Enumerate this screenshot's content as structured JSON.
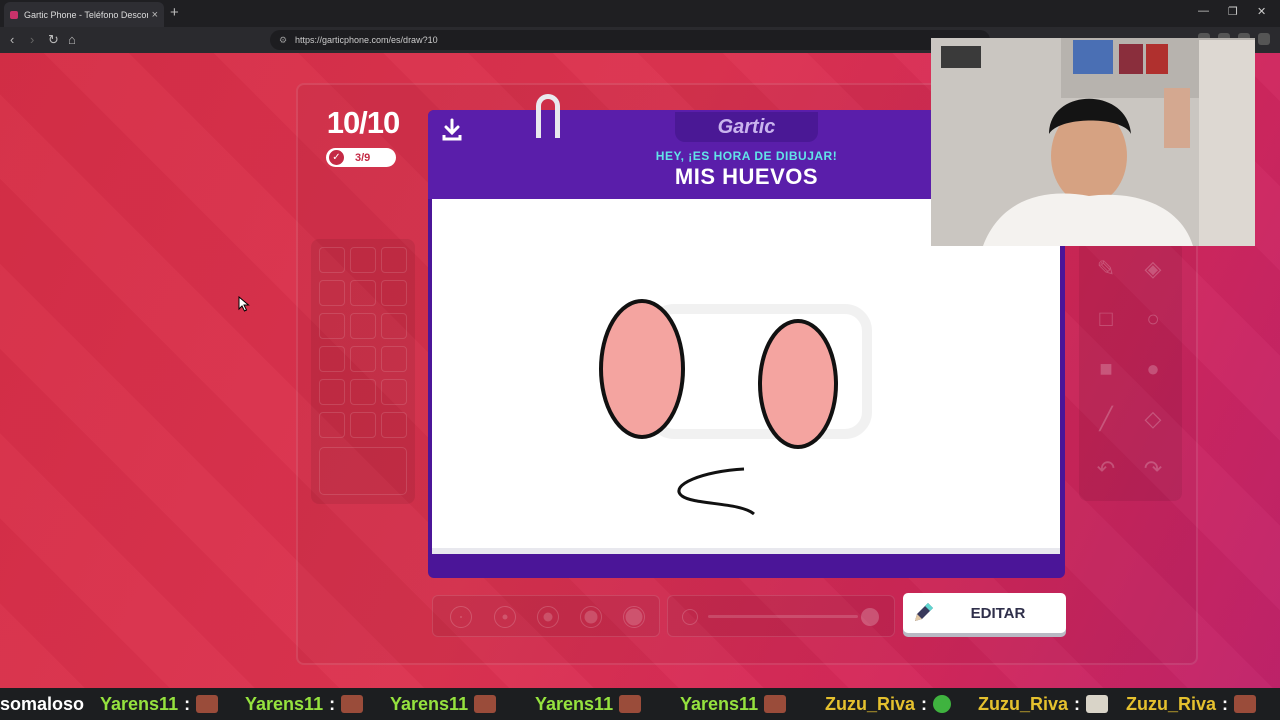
{
  "browser": {
    "tab_title": "Gartic Phone - Teléfono Descom...",
    "url": "https://garticphone.com/es/draw?10"
  },
  "game": {
    "round": "10/10",
    "done_count": "3/9",
    "logo": "Gartic",
    "prompt_sub": "HEY, ¡ES HORA DE DIBUJAR!",
    "prompt_word": "MIS HUEVOS",
    "edit_button": "EDITAR",
    "accent_purple": "#5a1eaa",
    "background_red": "#d8304a",
    "drawing_fill": "#f4a4a0"
  },
  "chat_ticker": [
    {
      "user": "somaloso",
      "separator": ""
    },
    {
      "user": "Yarens11",
      "separator": ":"
    },
    {
      "user": "Yarens11",
      "separator": ":"
    },
    {
      "user": "Yarens11",
      "separator": ""
    },
    {
      "user": "Yarens11",
      "separator": ""
    },
    {
      "user": "Yarens11",
      "separator": ""
    },
    {
      "user": "Zuzu_Riva",
      "separator": ":"
    },
    {
      "user": "Zuzu_Riva",
      "separator": ":"
    },
    {
      "user": "Zuzu_Riva",
      "separator": ":"
    }
  ]
}
